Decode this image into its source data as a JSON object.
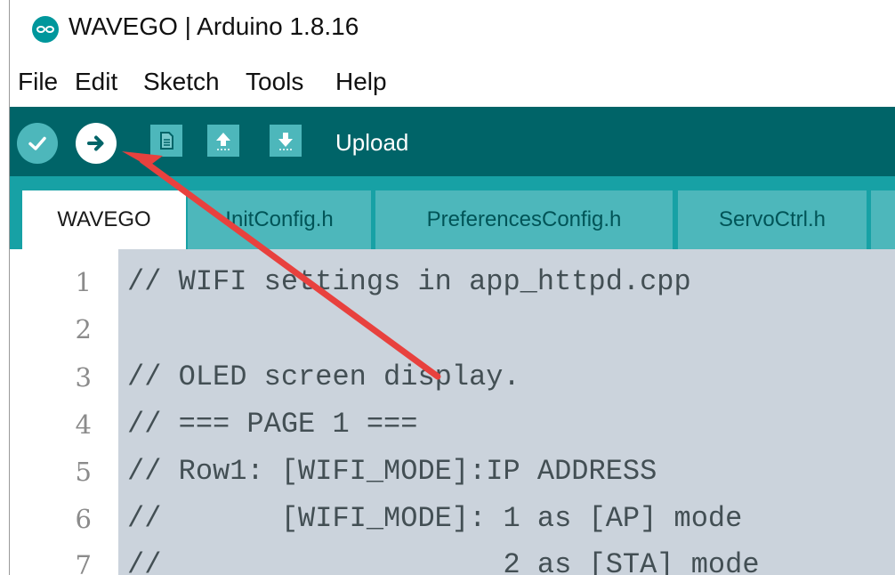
{
  "window": {
    "title": "WAVEGO | Arduino 1.8.16",
    "app_icon": "arduino-logo-icon"
  },
  "menubar": {
    "items": [
      "File",
      "Edit",
      "Sketch",
      "Tools",
      "Help"
    ]
  },
  "toolbar": {
    "hover_label": "Upload",
    "buttons": [
      "verify",
      "upload",
      "new",
      "open",
      "save"
    ],
    "accent_color": "#006468",
    "button_color": "#4db7bb"
  },
  "tabs": [
    {
      "label": "WAVEGO",
      "active": true
    },
    {
      "label": "InitConfig.h",
      "active": false
    },
    {
      "label": "PreferencesConfig.h",
      "active": false
    },
    {
      "label": "ServoCtrl.h",
      "active": false
    }
  ],
  "editor": {
    "lines": [
      {
        "no": "1",
        "text": "// WIFI settings in app_httpd.cpp"
      },
      {
        "no": "2",
        "text": ""
      },
      {
        "no": "3",
        "text": "// OLED screen display."
      },
      {
        "no": "4",
        "text": "// === PAGE 1 ==="
      },
      {
        "no": "5",
        "text": "// Row1: [WIFI_MODE]:IP ADDRESS"
      },
      {
        "no": "6",
        "text": "//       [WIFI_MODE]: 1 as [AP] mode"
      },
      {
        "no": "7",
        "text": "//                    2 as [STA] mode"
      }
    ]
  },
  "annotation": {
    "type": "red-arrow",
    "points_to": "upload-button",
    "color": "#e8413e"
  }
}
